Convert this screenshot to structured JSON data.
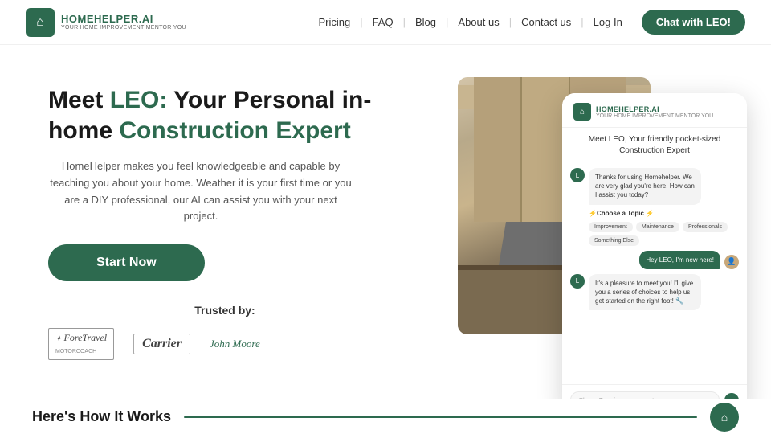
{
  "nav": {
    "logo_main": "HOMEHELPER.AI",
    "logo_sub": "YOUR HOME IMPROVEMENT MENTOR YOU",
    "links": [
      "Pricing",
      "FAQ",
      "Blog",
      "About us",
      "Contact us",
      "Log In"
    ],
    "cta_label": "Chat with LEO!"
  },
  "hero": {
    "headline_pre": "Meet ",
    "headline_leo": "LEO:",
    "headline_mid": " Your Personal in-home ",
    "headline_expert": "Construction Expert",
    "subtext": "HomeHelper makes you feel knowledgeable and capable by teaching you about your home. Weather it is your first time or you are a DIY professional, our AI can assist you with your next project.",
    "start_label": "Start Now",
    "trusted_label": "Trusted by:",
    "brands": [
      "ForeTravel",
      "Carrier",
      "John Moore"
    ]
  },
  "chat_card": {
    "logo_text": "HOMEHELPER.AI",
    "logo_sub": "YOUR HOME IMPROVEMENT MENTOR YOU",
    "title": "Meet LEO, Your friendly pocket-sized Construction Expert",
    "bot_msg1": "Thanks for using Homehelper. We are very glad you're here! How can I assist you today?",
    "choose_topic": "⚡Choose a Topic ⚡",
    "chips": [
      "Improvement",
      "Maintenance",
      "Professionals",
      "Something Else"
    ],
    "user_msg": "Hey LEO, I'm new here!",
    "bot_msg2": "It's a pleasure to meet you! I'll give you a series of choices to help us get started on the right foot! 🔧",
    "input_placeholder": "Please Type-in your request...",
    "send_icon": "→"
  },
  "bottom": {
    "title": "Here's How It Works",
    "icon": "⌂"
  }
}
